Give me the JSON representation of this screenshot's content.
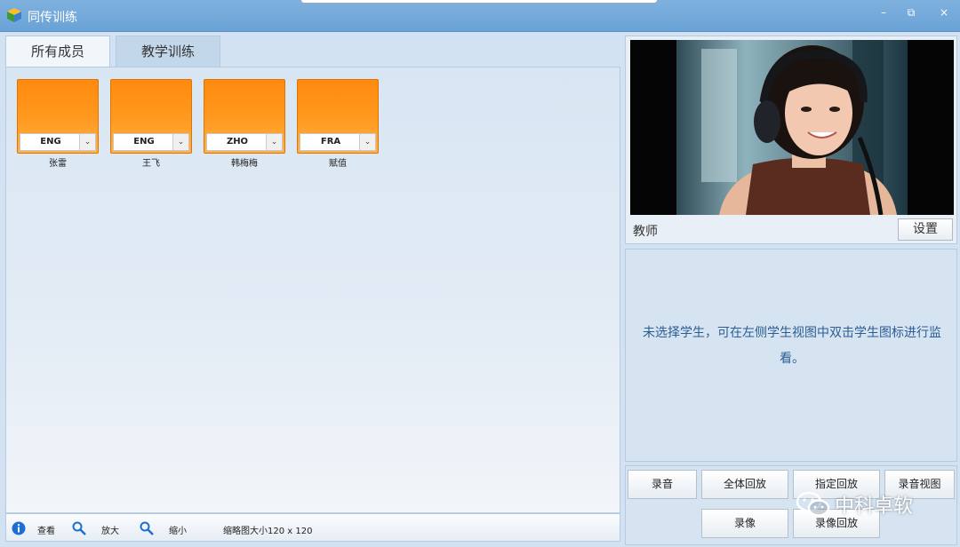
{
  "window": {
    "title": "同传训练",
    "minimize": "–",
    "maximize": "⧉",
    "close": "×"
  },
  "tabs": [
    {
      "label": "所有成员",
      "active": true
    },
    {
      "label": "教学训练",
      "active": false
    }
  ],
  "members": [
    {
      "lang": "ENG",
      "name": "张雷"
    },
    {
      "lang": "ENG",
      "name": "王飞"
    },
    {
      "lang": "ZHO",
      "name": "韩梅梅"
    },
    {
      "lang": "FRA",
      "name": "赋值"
    }
  ],
  "dropdown_glyph": "⌄",
  "statusbar": {
    "view_label": "查看",
    "zoom_in_label": "放大",
    "zoom_out_label": "缩小",
    "thumb_size_label": "缩略图大小120 x 120"
  },
  "teacher": {
    "label": "教师",
    "settings_label": "设置"
  },
  "monitor": {
    "message": "未选择学生，可在左侧学生视图中双击学生图标进行监看。"
  },
  "actions": {
    "record_audio": "录音",
    "playback_all": "全体回放",
    "playback_selected": "指定回放",
    "record_audio_video": "录音视图",
    "record_video": "录像",
    "playback_video": "录像回放"
  },
  "watermark": {
    "text": "中科卓软"
  },
  "colors": {
    "tile_orange": "#ff8a0e",
    "titlebar_blue": "#6aa2d6",
    "message_blue": "#2b5c93"
  },
  "icons": {
    "app": "app-cube-icon",
    "info": "info-icon",
    "zoom_in": "zoom-in-icon",
    "zoom_out": "zoom-out-icon",
    "wechat": "wechat-icon"
  }
}
